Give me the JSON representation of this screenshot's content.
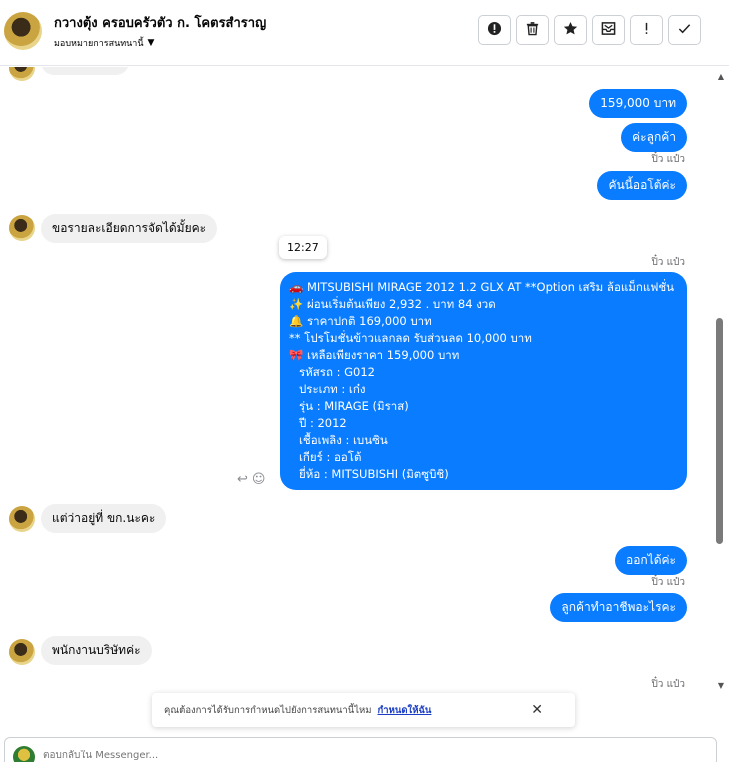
{
  "header": {
    "title": "กวางตุ้ง ครอบครัวตัว ก. โคตรสำราญ",
    "assign_label": "มอบหมายการสนทนานี้",
    "toolbar": [
      {
        "name": "spam-button",
        "icon": "alert-circle-icon",
        "glyph": "!"
      },
      {
        "name": "delete-button",
        "icon": "trash-icon",
        "glyph": "🗑"
      },
      {
        "name": "star-button",
        "icon": "star-icon",
        "glyph": "★"
      },
      {
        "name": "archive-button",
        "icon": "archive-icon",
        "glyph": "✉"
      },
      {
        "name": "mark-important-button",
        "icon": "exclamation-icon",
        "glyph": "!"
      },
      {
        "name": "done-button",
        "icon": "check-icon",
        "glyph": "✓"
      }
    ]
  },
  "thread": {
    "messages": [
      {
        "dir": "out",
        "text": "159,000 บาท"
      },
      {
        "dir": "out",
        "text": "ค่ะลูกค้า"
      },
      {
        "dir": "out",
        "text": "คันนี้ออโต้ค่ะ"
      },
      {
        "dir": "in",
        "text": "ขอรายละเอียดการจัดได้มั้ยคะ"
      },
      {
        "dir": "in",
        "text": "แต่ว่าอยู่ที่ ขก.นะคะ"
      },
      {
        "dir": "out",
        "text": "ออกได้ค่ะ"
      },
      {
        "dir": "out",
        "text": "ลูกค้าทำอาชีพอะไรคะ"
      },
      {
        "dir": "in",
        "text": "พนักงานบริษัทค่ะ"
      }
    ],
    "seen_label": "ปิ๋ว แป๋ว",
    "time_tooltip": "12:27",
    "car_listing": [
      "🚗  MITSUBISHI MIRAGE 2012 1.2 GLX AT **Option เสริม ล้อแม็กแฟชั่น",
      "✨  ผ่อนเริ่มต้นเพียง 2,932 . บาท 84 งวด",
      "🔔  ราคาปกติ 169,000 บาท",
      "** โปรโมชั่นข้าวแลกลด รับส่วนลด 10,000 บาท",
      "🎀  เหลือเพียงราคา 159,000 บาท",
      "รหัสรถ : G012",
      "ประเภท : เก๋ง",
      "รุ่น : MIRAGE (มิราส)",
      "ปี : 2012",
      "เชื้อเพลิง : เบนซิน",
      "เกียร์ : ออโต้",
      "ยี่ห้อ : MITSUBISHI (มิตซูบิชิ)"
    ]
  },
  "banner": {
    "text": "คุณต้องการได้รับการกำหนดไปยังการสนทนานี้ไหม",
    "link": "กำหนดให้ฉัน"
  },
  "composer": {
    "placeholder": "ตอบกลับใน Messenger..."
  }
}
